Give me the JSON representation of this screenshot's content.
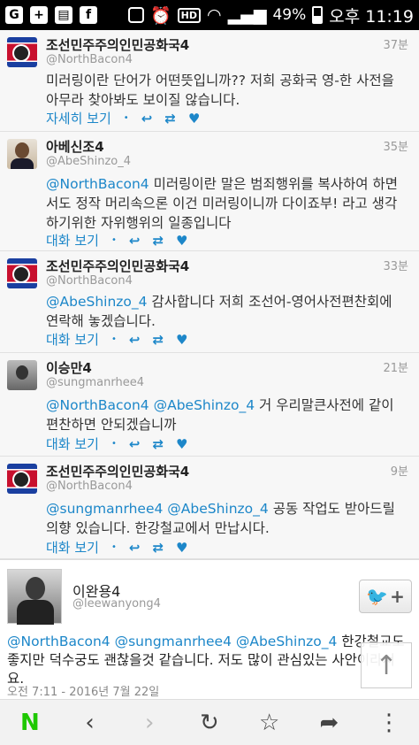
{
  "status_bar": {
    "battery": "49%",
    "time": "오후 11:19",
    "hd": "HD",
    "icons": [
      "app-g-icon",
      "add-icon",
      "flag-icon",
      "facebook-icon",
      "vibrate-icon",
      "alarm-icon",
      "hd-icon",
      "wifi-icon",
      "signal-icon",
      "battery-icon"
    ]
  },
  "tweets": [
    {
      "name": "조선민주주의인민공화국4",
      "handle": "@NorthBacon4",
      "time": "37분",
      "text": "미러링이란 단어가 어떤뜻입니까?? 저희 공화국 영-한 사전을 아무라 찾아봐도 보이질 않습니다.",
      "action_label": "자세히 보기"
    },
    {
      "name": "아베신조4",
      "handle": "@AbeShinzo_4",
      "time": "35분",
      "mention": "@NorthBacon4",
      "text": " 미러링이란 말은 범죄행위를 복사하여 하면서도 정작 머리속으론 이건 미러링이니까 다이죠부! 라고 생각하기위한 자위행위의 일종입니다",
      "action_label": "대화 보기"
    },
    {
      "name": "조선민주주의인민공화국4",
      "handle": "@NorthBacon4",
      "time": "33분",
      "mention": "@AbeShinzo_4",
      "text": " 감사합니다 저희 조선어-영어사전편찬회에 연락해 놓겠습니다.",
      "action_label": "대화 보기"
    },
    {
      "name": "이승만4",
      "handle": "@sungmanrhee4",
      "time": "21분",
      "mention": "@NorthBacon4 @AbeShinzo_4",
      "text": " 거 우리말큰사전에 같이 편찬하면 안되겠습니까",
      "action_label": "대화 보기"
    },
    {
      "name": "조선민주주의인민공화국4",
      "handle": "@NorthBacon4",
      "time": "9분",
      "mention": "@sungmanrhee4 @AbeShinzo_4",
      "text": " 공동 작업도 받아드릴 의향 있습니다. 한강철교에서 만납시다.",
      "action_label": "대화 보기"
    }
  ],
  "detail": {
    "name": "이완용4",
    "handle": "@leewanyong4",
    "mention": "@NorthBacon4 @sungmanrhee4 @AbeShinzo_4",
    "text": " 한강철교도 좋지만 덕수궁도 괜찮을것 같습니다. 저도 많이 관심있는 사안이라서요.",
    "timestamp": "오전 7:11 - 2016년 7월 22일"
  },
  "bottom_nav": {
    "n_label": "N"
  }
}
